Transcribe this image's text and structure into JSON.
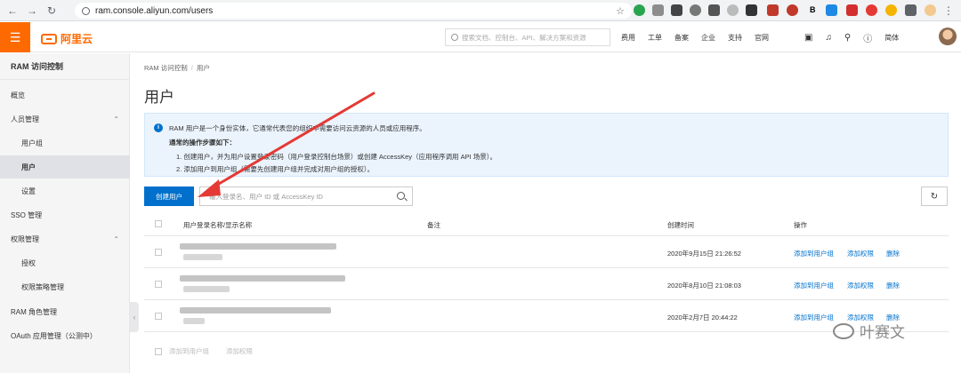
{
  "browser": {
    "url": "ram.console.aliyun.com/users",
    "ext_labels": [
      "B",
      "E"
    ]
  },
  "header": {
    "menu_icon": "menu-icon",
    "logo_text": "阿里云",
    "search_placeholder": "搜索文档、控制台、API、解决方案和资源",
    "links": [
      "费用",
      "工单",
      "备案",
      "企业",
      "支持",
      "官网"
    ],
    "lang": "简体"
  },
  "sidebar": {
    "title": "RAM 访问控制",
    "items": [
      {
        "label": "概览"
      },
      {
        "label": "人员管理"
      },
      {
        "label": "用户组"
      },
      {
        "label": "用户"
      },
      {
        "label": "设置"
      },
      {
        "label": "SSO 管理"
      },
      {
        "label": "权限管理"
      },
      {
        "label": "授权"
      },
      {
        "label": "权限策略管理"
      },
      {
        "label": "RAM 角色管理"
      },
      {
        "label": "OAuth 应用管理（公测中）"
      }
    ]
  },
  "breadcrumb": {
    "root": "RAM 访问控制",
    "sep": "/",
    "current": "用户"
  },
  "page_title": "用户",
  "info": {
    "line1": "RAM 用户是一个身份实体，它通常代表您的组织中需要访问云资源的人员或应用程序。",
    "line2": "通常的操作步骤如下：",
    "line3": "1. 创建用户，并为用户设置登录密码（用户登录控制台场景）或创建 AccessKey（应用程序调用 API 场景）。",
    "line4": "2. 添加用户到用户组（需要先创建用户组并完成对用户组的授权）。"
  },
  "toolbar": {
    "create_label": "创建用户",
    "search_placeholder": "输入登录名、用户 ID 或 AccessKey ID",
    "refresh_icon": "refresh-icon"
  },
  "table": {
    "headers": [
      "用户登录名称/显示名称",
      "备注",
      "创建时间",
      "操作"
    ],
    "rows": [
      {
        "created": "2020年9月15日 21:26:52"
      },
      {
        "created": "2020年8月10日 21:08:03"
      },
      {
        "created": "2020年2月7日 20:44:22"
      }
    ],
    "actions": [
      "添加到用户组",
      "添加权限",
      "删除"
    ],
    "footer_actions": [
      "添加到用户组",
      "添加权限"
    ]
  },
  "watermark": {
    "text": "叶赛文"
  },
  "colors": {
    "brand": "#ff6a00",
    "primary": "#0070cc",
    "arrow": "#e53935"
  }
}
